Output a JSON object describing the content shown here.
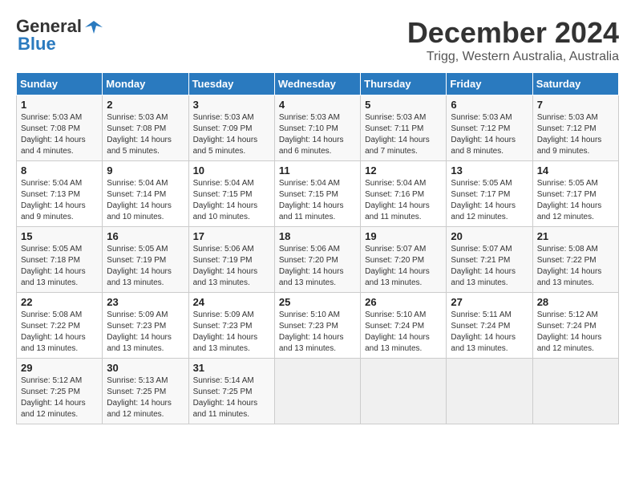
{
  "logo": {
    "line1": "General",
    "line2": "Blue"
  },
  "title": "December 2024",
  "subtitle": "Trigg, Western Australia, Australia",
  "columns": [
    "Sunday",
    "Monday",
    "Tuesday",
    "Wednesday",
    "Thursday",
    "Friday",
    "Saturday"
  ],
  "weeks": [
    [
      {
        "day": "1",
        "info": "Sunrise: 5:03 AM\nSunset: 7:08 PM\nDaylight: 14 hours\nand 4 minutes."
      },
      {
        "day": "2",
        "info": "Sunrise: 5:03 AM\nSunset: 7:08 PM\nDaylight: 14 hours\nand 5 minutes."
      },
      {
        "day": "3",
        "info": "Sunrise: 5:03 AM\nSunset: 7:09 PM\nDaylight: 14 hours\nand 5 minutes."
      },
      {
        "day": "4",
        "info": "Sunrise: 5:03 AM\nSunset: 7:10 PM\nDaylight: 14 hours\nand 6 minutes."
      },
      {
        "day": "5",
        "info": "Sunrise: 5:03 AM\nSunset: 7:11 PM\nDaylight: 14 hours\nand 7 minutes."
      },
      {
        "day": "6",
        "info": "Sunrise: 5:03 AM\nSunset: 7:12 PM\nDaylight: 14 hours\nand 8 minutes."
      },
      {
        "day": "7",
        "info": "Sunrise: 5:03 AM\nSunset: 7:12 PM\nDaylight: 14 hours\nand 9 minutes."
      }
    ],
    [
      {
        "day": "8",
        "info": "Sunrise: 5:04 AM\nSunset: 7:13 PM\nDaylight: 14 hours\nand 9 minutes."
      },
      {
        "day": "9",
        "info": "Sunrise: 5:04 AM\nSunset: 7:14 PM\nDaylight: 14 hours\nand 10 minutes."
      },
      {
        "day": "10",
        "info": "Sunrise: 5:04 AM\nSunset: 7:15 PM\nDaylight: 14 hours\nand 10 minutes."
      },
      {
        "day": "11",
        "info": "Sunrise: 5:04 AM\nSunset: 7:15 PM\nDaylight: 14 hours\nand 11 minutes."
      },
      {
        "day": "12",
        "info": "Sunrise: 5:04 AM\nSunset: 7:16 PM\nDaylight: 14 hours\nand 11 minutes."
      },
      {
        "day": "13",
        "info": "Sunrise: 5:05 AM\nSunset: 7:17 PM\nDaylight: 14 hours\nand 12 minutes."
      },
      {
        "day": "14",
        "info": "Sunrise: 5:05 AM\nSunset: 7:17 PM\nDaylight: 14 hours\nand 12 minutes."
      }
    ],
    [
      {
        "day": "15",
        "info": "Sunrise: 5:05 AM\nSunset: 7:18 PM\nDaylight: 14 hours\nand 13 minutes."
      },
      {
        "day": "16",
        "info": "Sunrise: 5:05 AM\nSunset: 7:19 PM\nDaylight: 14 hours\nand 13 minutes."
      },
      {
        "day": "17",
        "info": "Sunrise: 5:06 AM\nSunset: 7:19 PM\nDaylight: 14 hours\nand 13 minutes."
      },
      {
        "day": "18",
        "info": "Sunrise: 5:06 AM\nSunset: 7:20 PM\nDaylight: 14 hours\nand 13 minutes."
      },
      {
        "day": "19",
        "info": "Sunrise: 5:07 AM\nSunset: 7:20 PM\nDaylight: 14 hours\nand 13 minutes."
      },
      {
        "day": "20",
        "info": "Sunrise: 5:07 AM\nSunset: 7:21 PM\nDaylight: 14 hours\nand 13 minutes."
      },
      {
        "day": "21",
        "info": "Sunrise: 5:08 AM\nSunset: 7:22 PM\nDaylight: 14 hours\nand 13 minutes."
      }
    ],
    [
      {
        "day": "22",
        "info": "Sunrise: 5:08 AM\nSunset: 7:22 PM\nDaylight: 14 hours\nand 13 minutes."
      },
      {
        "day": "23",
        "info": "Sunrise: 5:09 AM\nSunset: 7:23 PM\nDaylight: 14 hours\nand 13 minutes."
      },
      {
        "day": "24",
        "info": "Sunrise: 5:09 AM\nSunset: 7:23 PM\nDaylight: 14 hours\nand 13 minutes."
      },
      {
        "day": "25",
        "info": "Sunrise: 5:10 AM\nSunset: 7:23 PM\nDaylight: 14 hours\nand 13 minutes."
      },
      {
        "day": "26",
        "info": "Sunrise: 5:10 AM\nSunset: 7:24 PM\nDaylight: 14 hours\nand 13 minutes."
      },
      {
        "day": "27",
        "info": "Sunrise: 5:11 AM\nSunset: 7:24 PM\nDaylight: 14 hours\nand 13 minutes."
      },
      {
        "day": "28",
        "info": "Sunrise: 5:12 AM\nSunset: 7:24 PM\nDaylight: 14 hours\nand 12 minutes."
      }
    ],
    [
      {
        "day": "29",
        "info": "Sunrise: 5:12 AM\nSunset: 7:25 PM\nDaylight: 14 hours\nand 12 minutes."
      },
      {
        "day": "30",
        "info": "Sunrise: 5:13 AM\nSunset: 7:25 PM\nDaylight: 14 hours\nand 12 minutes."
      },
      {
        "day": "31",
        "info": "Sunrise: 5:14 AM\nSunset: 7:25 PM\nDaylight: 14 hours\nand 11 minutes."
      },
      {
        "day": "",
        "info": ""
      },
      {
        "day": "",
        "info": ""
      },
      {
        "day": "",
        "info": ""
      },
      {
        "day": "",
        "info": ""
      }
    ]
  ]
}
